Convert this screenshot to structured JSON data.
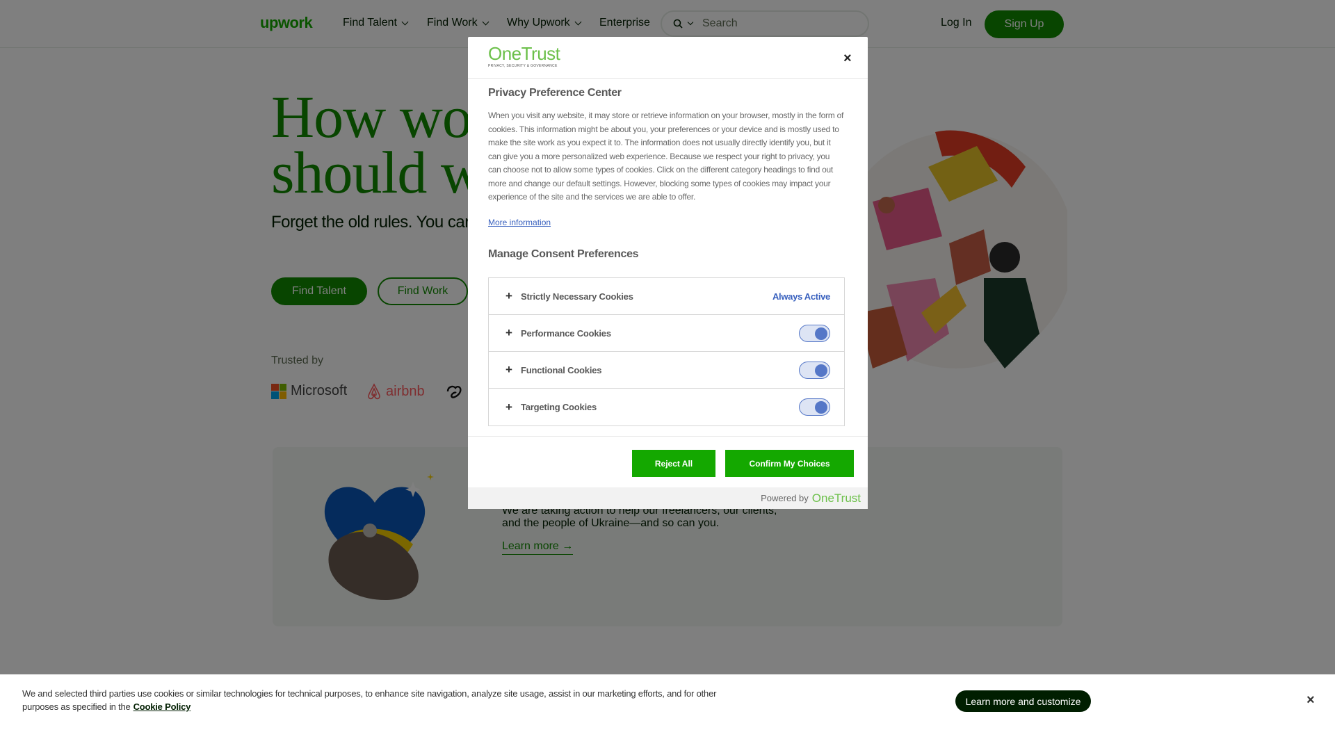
{
  "header": {
    "logo": "upwork",
    "nav": [
      "Find Talent",
      "Find Work",
      "Why Upwork",
      "Enterprise"
    ],
    "search_placeholder": "Search",
    "login": "Log In",
    "signup": "Sign Up"
  },
  "hero": {
    "title_line1": "How wo",
    "title_line2": "should w",
    "subtitle": "Forget the old rules. You car Right now. Right here.",
    "find_talent": "Find Talent",
    "find_work": "Find Work",
    "trusted_by": "Trusted by",
    "brands": [
      "Microsoft",
      "airbnb"
    ]
  },
  "ukraine_card": {
    "text": "We are taking action to help our freelancers, our clients, and the people of Ukraine—and so can you.",
    "link": "Learn more →"
  },
  "modal": {
    "logo": "OneTrust",
    "logo_tagline": "PRIVACY, SECURITY & GOVERNANCE",
    "close": "×",
    "title": "Privacy Preference Center",
    "description": "When you visit any website, it may store or retrieve information on your browser, mostly in the form of cookies. This information might be about you, your preferences or your device and is mostly used to make the site work as you expect it to. The information does not usually directly identify you, but it can give you a more personalized web experience. Because we respect your right to privacy, you can choose not to allow some types of cookies. Click on the different category headings to find out more and change our default settings. However, blocking some types of cookies may impact your experience of the site and the services we are able to offer.",
    "more_info": "More information",
    "manage_title": "Manage Consent Preferences",
    "categories": [
      {
        "label": "Strictly Necessary Cookies",
        "status": "Always Active"
      },
      {
        "label": "Performance Cookies",
        "enabled": true
      },
      {
        "label": "Functional Cookies",
        "enabled": true
      },
      {
        "label": "Targeting Cookies",
        "enabled": true
      }
    ],
    "reject_all": "Reject All",
    "confirm": "Confirm My Choices",
    "powered_by": "Powered by",
    "powered_brand": "OneTrust"
  },
  "banner": {
    "text": "We and selected third parties use cookies or similar technologies for technical purposes, to enhance site navigation, analyze site usage, assist in our marketing efforts, and for other purposes as specified in the",
    "policy_link": "Cookie Policy",
    "customize": "Learn more and customize",
    "close": "×"
  },
  "colors": {
    "brand_green": "#14a800",
    "dark_green": "#108a00",
    "onetrust_blue": "#3860be"
  }
}
